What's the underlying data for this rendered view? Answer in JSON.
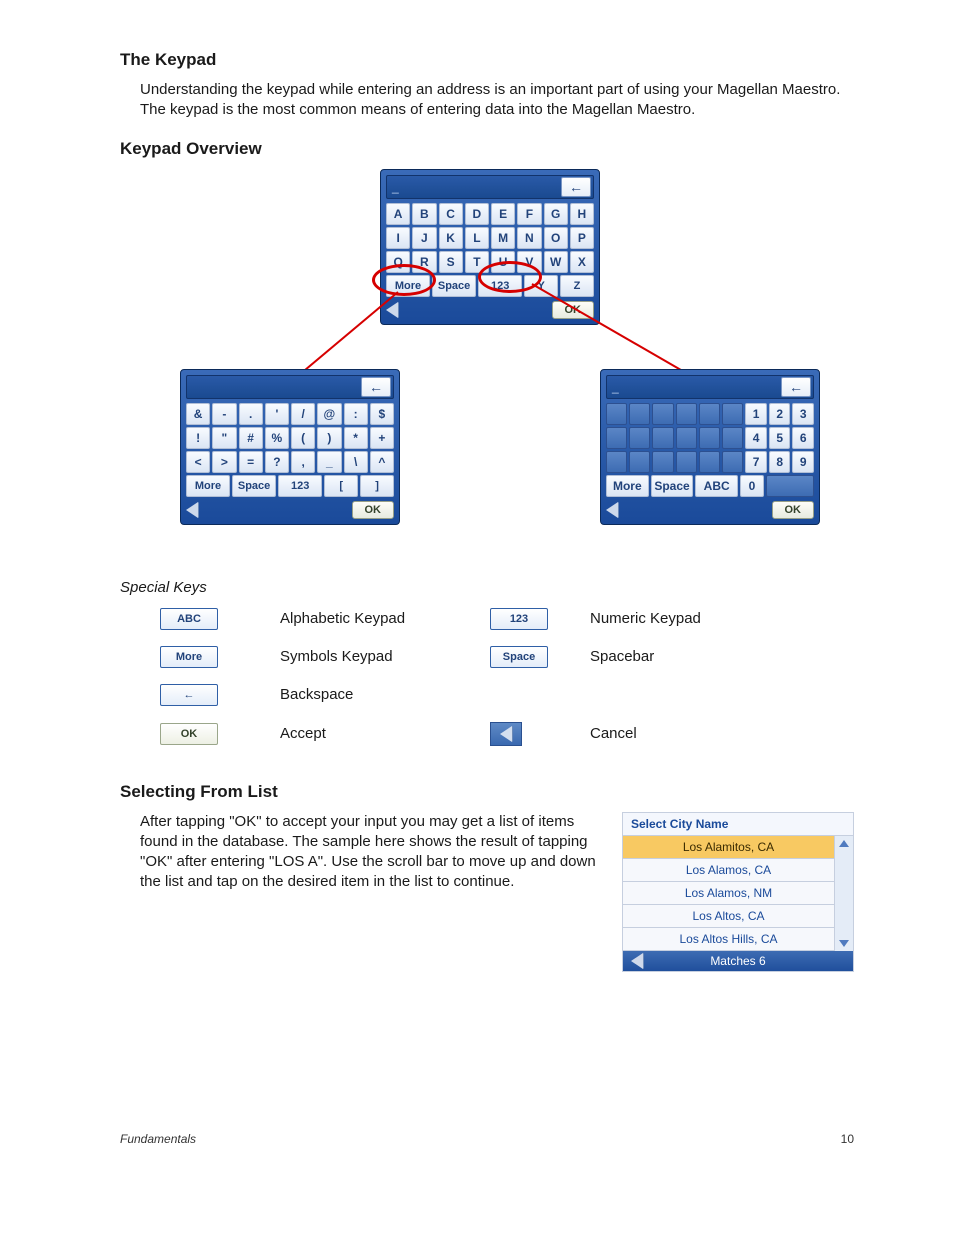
{
  "section1": {
    "heading": "The Keypad",
    "body": "Understanding the keypad while entering an address is an important part of using your Magellan Maestro.  The keypad is the most common means of entering data into the Magellan Maestro."
  },
  "section2": {
    "heading": "Keypad Overview"
  },
  "alpha_keys": [
    "A",
    "B",
    "C",
    "D",
    "E",
    "F",
    "G",
    "H",
    "I",
    "J",
    "K",
    "L",
    "M",
    "N",
    "O",
    "P",
    "Q",
    "R",
    "S",
    "T",
    "U",
    "V",
    "W",
    "X"
  ],
  "alpha_bottom": {
    "more": "More",
    "space": "Space",
    "num": "123",
    "y": "Y",
    "z": "Z"
  },
  "sym_keys": [
    "&",
    "-",
    ".",
    "'",
    "/",
    "@",
    ":",
    "$",
    "!",
    "\"",
    "#",
    "%",
    "(",
    ")",
    "*",
    "+",
    "<",
    ">",
    "=",
    "?",
    ",",
    "_",
    "\\",
    "^"
  ],
  "sym_bottom": {
    "more": "More",
    "space": "Space",
    "num": "123",
    "l": "[",
    "r": "]"
  },
  "num_keys": [
    "1",
    "2",
    "3",
    "4",
    "5",
    "6",
    "7",
    "8",
    "9",
    "0"
  ],
  "num_bottom": {
    "more": "More",
    "space": "Space",
    "abc": "ABC"
  },
  "ok_label": "OK",
  "back_glyph": "←",
  "special": {
    "heading": "Special Keys",
    "rows": [
      {
        "btn": "ABC",
        "desc": "Alphabetic Keypad",
        "btn2": "123",
        "desc2": "Numeric Keypad"
      },
      {
        "btn": "More",
        "desc": "Symbols Keypad",
        "btn2": "Space",
        "desc2": "Spacebar"
      },
      {
        "btn": "←",
        "desc": "Backspace",
        "btn2": "",
        "desc2": ""
      },
      {
        "btn": "OK",
        "desc": "Accept",
        "btn2": "◀",
        "desc2": "Cancel"
      }
    ]
  },
  "section3": {
    "heading": "Selecting From List",
    "body": "After tapping \"OK\" to accept your input you may get a list of items found in the database.  The sample here shows the result of tapping \"OK\" after entering \"LOS A\".  Use the scroll bar to move up and down the list and tap on the desired item in the list to continue."
  },
  "list": {
    "title": "Select City Name",
    "items": [
      "Los Alamitos, CA",
      "Los Alamos, CA",
      "Los Alamos, NM",
      "Los Altos, CA",
      "Los Altos Hills, CA"
    ],
    "selected": 0,
    "matches": "Matches  6"
  },
  "footer": {
    "section": "Fundamentals",
    "page": "10"
  }
}
